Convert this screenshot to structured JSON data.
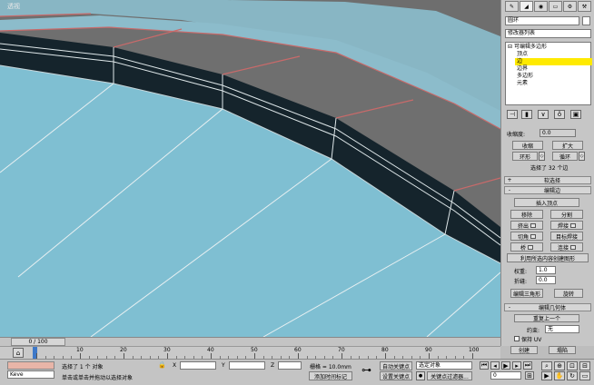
{
  "viewport": {
    "label": "透视"
  },
  "panel": {
    "tabs": [
      "✎",
      "◢",
      "◉",
      "▭",
      "⚙",
      "⚒"
    ],
    "object_name": "圆环",
    "modifier_list": "修改器列表",
    "stack": {
      "root": "可编辑多边形",
      "items": [
        "顶点",
        "边",
        "边界",
        "多边形",
        "元素"
      ],
      "selected_index": 1
    },
    "soft_label": "收缩度:",
    "soft_value": "0.0",
    "shrink": "收缩",
    "grow": "扩大",
    "ring": "环形",
    "loop": "循环",
    "selection_status": "选择了 32 个边",
    "rollout_soft": "软选择",
    "rollout_edit_edges": "编辑边",
    "insert_vertex": "插入顶点",
    "remove": "移除",
    "split": "分割",
    "extrude": "挤出",
    "weld": "焊接",
    "chamfer": "切角",
    "target_weld": "目标焊接",
    "bridge": "桥",
    "connect": "连接",
    "create_shape": "利用所选内容创建图形",
    "weight_label": "权重:",
    "weight_value": "1.0",
    "crease_label": "折缝:",
    "crease_value": "0.0",
    "edit_tri": "编辑三角形",
    "turn": "旋转",
    "rollout_edit_geo": "编辑几何体",
    "repeat_last": "重复上一个",
    "constraint_label": "约束:",
    "constraint_value": "无",
    "preserve_uv": "保持 UV",
    "create": "创建",
    "collapse": "塌陷"
  },
  "timeline": {
    "frame": "0 / 100"
  },
  "ruler": {
    "ticks": [
      "0",
      "10",
      "20",
      "30",
      "40",
      "50",
      "60",
      "70",
      "80",
      "90",
      "100"
    ]
  },
  "status": {
    "script_value": "Keve",
    "selection": "选择了 1 个 对象",
    "prompt": "单击或单击并拖动以选择对象",
    "grid": "栅格 = 10.0mm",
    "add_time_tag": "添加时间标记",
    "auto_key": "自动关键点",
    "set_key": "设置关键点",
    "selected_object": "选定对象",
    "key_filters": "关键点过滤器...",
    "frame_value": "0"
  }
}
